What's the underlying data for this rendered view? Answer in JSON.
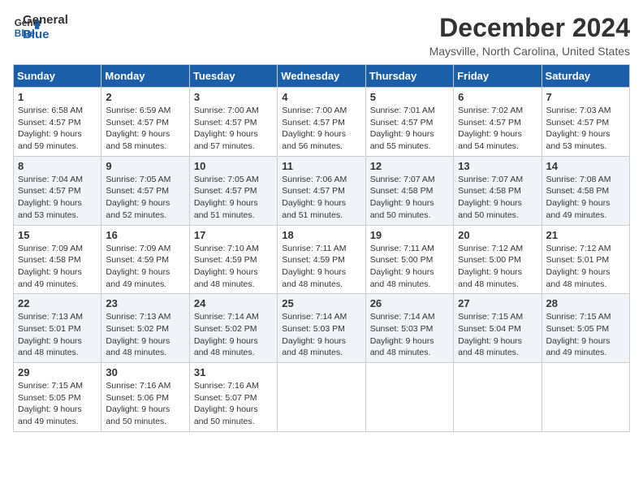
{
  "header": {
    "logo_line1": "General",
    "logo_line2": "Blue",
    "month": "December 2024",
    "location": "Maysville, North Carolina, United States"
  },
  "days": [
    "Sunday",
    "Monday",
    "Tuesday",
    "Wednesday",
    "Thursday",
    "Friday",
    "Saturday"
  ],
  "weeks": [
    [
      {
        "day": "1",
        "sunrise": "Sunrise: 6:58 AM",
        "sunset": "Sunset: 4:57 PM",
        "daylight": "Daylight: 9 hours and 59 minutes."
      },
      {
        "day": "2",
        "sunrise": "Sunrise: 6:59 AM",
        "sunset": "Sunset: 4:57 PM",
        "daylight": "Daylight: 9 hours and 58 minutes."
      },
      {
        "day": "3",
        "sunrise": "Sunrise: 7:00 AM",
        "sunset": "Sunset: 4:57 PM",
        "daylight": "Daylight: 9 hours and 57 minutes."
      },
      {
        "day": "4",
        "sunrise": "Sunrise: 7:00 AM",
        "sunset": "Sunset: 4:57 PM",
        "daylight": "Daylight: 9 hours and 56 minutes."
      },
      {
        "day": "5",
        "sunrise": "Sunrise: 7:01 AM",
        "sunset": "Sunset: 4:57 PM",
        "daylight": "Daylight: 9 hours and 55 minutes."
      },
      {
        "day": "6",
        "sunrise": "Sunrise: 7:02 AM",
        "sunset": "Sunset: 4:57 PM",
        "daylight": "Daylight: 9 hours and 54 minutes."
      },
      {
        "day": "7",
        "sunrise": "Sunrise: 7:03 AM",
        "sunset": "Sunset: 4:57 PM",
        "daylight": "Daylight: 9 hours and 53 minutes."
      }
    ],
    [
      {
        "day": "8",
        "sunrise": "Sunrise: 7:04 AM",
        "sunset": "Sunset: 4:57 PM",
        "daylight": "Daylight: 9 hours and 53 minutes."
      },
      {
        "day": "9",
        "sunrise": "Sunrise: 7:05 AM",
        "sunset": "Sunset: 4:57 PM",
        "daylight": "Daylight: 9 hours and 52 minutes."
      },
      {
        "day": "10",
        "sunrise": "Sunrise: 7:05 AM",
        "sunset": "Sunset: 4:57 PM",
        "daylight": "Daylight: 9 hours and 51 minutes."
      },
      {
        "day": "11",
        "sunrise": "Sunrise: 7:06 AM",
        "sunset": "Sunset: 4:57 PM",
        "daylight": "Daylight: 9 hours and 51 minutes."
      },
      {
        "day": "12",
        "sunrise": "Sunrise: 7:07 AM",
        "sunset": "Sunset: 4:58 PM",
        "daylight": "Daylight: 9 hours and 50 minutes."
      },
      {
        "day": "13",
        "sunrise": "Sunrise: 7:07 AM",
        "sunset": "Sunset: 4:58 PM",
        "daylight": "Daylight: 9 hours and 50 minutes."
      },
      {
        "day": "14",
        "sunrise": "Sunrise: 7:08 AM",
        "sunset": "Sunset: 4:58 PM",
        "daylight": "Daylight: 9 hours and 49 minutes."
      }
    ],
    [
      {
        "day": "15",
        "sunrise": "Sunrise: 7:09 AM",
        "sunset": "Sunset: 4:58 PM",
        "daylight": "Daylight: 9 hours and 49 minutes."
      },
      {
        "day": "16",
        "sunrise": "Sunrise: 7:09 AM",
        "sunset": "Sunset: 4:59 PM",
        "daylight": "Daylight: 9 hours and 49 minutes."
      },
      {
        "day": "17",
        "sunrise": "Sunrise: 7:10 AM",
        "sunset": "Sunset: 4:59 PM",
        "daylight": "Daylight: 9 hours and 48 minutes."
      },
      {
        "day": "18",
        "sunrise": "Sunrise: 7:11 AM",
        "sunset": "Sunset: 4:59 PM",
        "daylight": "Daylight: 9 hours and 48 minutes."
      },
      {
        "day": "19",
        "sunrise": "Sunrise: 7:11 AM",
        "sunset": "Sunset: 5:00 PM",
        "daylight": "Daylight: 9 hours and 48 minutes."
      },
      {
        "day": "20",
        "sunrise": "Sunrise: 7:12 AM",
        "sunset": "Sunset: 5:00 PM",
        "daylight": "Daylight: 9 hours and 48 minutes."
      },
      {
        "day": "21",
        "sunrise": "Sunrise: 7:12 AM",
        "sunset": "Sunset: 5:01 PM",
        "daylight": "Daylight: 9 hours and 48 minutes."
      }
    ],
    [
      {
        "day": "22",
        "sunrise": "Sunrise: 7:13 AM",
        "sunset": "Sunset: 5:01 PM",
        "daylight": "Daylight: 9 hours and 48 minutes."
      },
      {
        "day": "23",
        "sunrise": "Sunrise: 7:13 AM",
        "sunset": "Sunset: 5:02 PM",
        "daylight": "Daylight: 9 hours and 48 minutes."
      },
      {
        "day": "24",
        "sunrise": "Sunrise: 7:14 AM",
        "sunset": "Sunset: 5:02 PM",
        "daylight": "Daylight: 9 hours and 48 minutes."
      },
      {
        "day": "25",
        "sunrise": "Sunrise: 7:14 AM",
        "sunset": "Sunset: 5:03 PM",
        "daylight": "Daylight: 9 hours and 48 minutes."
      },
      {
        "day": "26",
        "sunrise": "Sunrise: 7:14 AM",
        "sunset": "Sunset: 5:03 PM",
        "daylight": "Daylight: 9 hours and 48 minutes."
      },
      {
        "day": "27",
        "sunrise": "Sunrise: 7:15 AM",
        "sunset": "Sunset: 5:04 PM",
        "daylight": "Daylight: 9 hours and 48 minutes."
      },
      {
        "day": "28",
        "sunrise": "Sunrise: 7:15 AM",
        "sunset": "Sunset: 5:05 PM",
        "daylight": "Daylight: 9 hours and 49 minutes."
      }
    ],
    [
      {
        "day": "29",
        "sunrise": "Sunrise: 7:15 AM",
        "sunset": "Sunset: 5:05 PM",
        "daylight": "Daylight: 9 hours and 49 minutes."
      },
      {
        "day": "30",
        "sunrise": "Sunrise: 7:16 AM",
        "sunset": "Sunset: 5:06 PM",
        "daylight": "Daylight: 9 hours and 50 minutes."
      },
      {
        "day": "31",
        "sunrise": "Sunrise: 7:16 AM",
        "sunset": "Sunset: 5:07 PM",
        "daylight": "Daylight: 9 hours and 50 minutes."
      },
      null,
      null,
      null,
      null
    ]
  ]
}
